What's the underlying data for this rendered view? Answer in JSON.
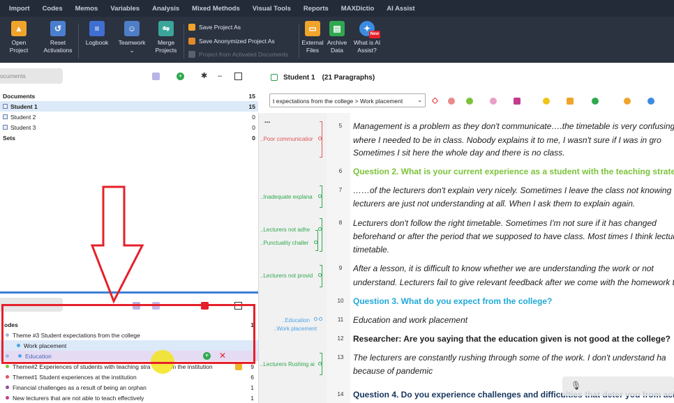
{
  "menu": [
    "Import",
    "Codes",
    "Memos",
    "Variables",
    "Analysis",
    "Mixed Methods",
    "Visual Tools",
    "Reports",
    "MAXDictio",
    "AI Assist"
  ],
  "ribbon": {
    "open_project": "Open Project",
    "reset_activations": "Reset Activations",
    "logbook": "Logbook",
    "teamwork": "Teamwork",
    "merge_projects": "Merge Projects",
    "save_project_as": "Save Project As",
    "save_anonymized": "Save Anonymized Project As",
    "project_from_activated": "Project from Activated Documents",
    "external_files": "External Files",
    "archive_data": "Archive Data",
    "what_is_ai": "What is AI Assist?",
    "new_badge": "New"
  },
  "documents_panel": {
    "search_placeholder": "ocuments",
    "root": {
      "label": "Documents",
      "count": "15"
    },
    "items": [
      {
        "label": "Student 1",
        "count": "15"
      },
      {
        "label": "Student 2",
        "count": "0"
      },
      {
        "label": "Student 3",
        "count": "0"
      }
    ],
    "sets": {
      "label": "Sets",
      "count": "0"
    }
  },
  "codes_panel": {
    "root": {
      "label": "odes",
      "count": "1"
    },
    "items": [
      {
        "label": "Theme #3 Student expectations from the college",
        "count": "",
        "color": "#9fb9d9"
      },
      {
        "label": "Work placement",
        "count": "",
        "color": "#4da3e6"
      },
      {
        "label": "Education",
        "count": "",
        "color": "#4da3e6"
      },
      {
        "label": "Theme#2 Experiences of students with teaching stra",
        "label_end": "in the institution",
        "count": "9",
        "color": "#7bc33a"
      },
      {
        "label": "Theme#1 Student experiences at the institution",
        "count": "6",
        "color": "#e05555"
      },
      {
        "label": "Financial challenges as a result of being an orphan",
        "count": "1",
        "color": "#8a4f9e"
      },
      {
        "label": "New lecturers that are not able to teach effectively",
        "count": "1",
        "color": "#c23c8f"
      }
    ]
  },
  "document_view": {
    "title": "Student 1",
    "subtitle": "(21 Paragraphs)",
    "code_path": "t expectations from the college  > Work placement",
    "code_tags": [
      "..Poor communicatior",
      "..Inadequate explana",
      "..Lecturers not adhe",
      "..Punctuality challer",
      "..Lecturers not provid",
      "..Education",
      "..Work placement",
      "..Lecturers Rushing ai"
    ],
    "ellipsis": "...",
    "paragraphs": [
      {
        "num": "5",
        "lines": [
          " Management is a problem as they don't communicate….the timetable is very confusing",
          "where I needed to be in class. Nobody explains it to me, I wasn't sure if I was in gro",
          "Sometimes I sit here the whole day and there is no class."
        ]
      },
      {
        "num": "6",
        "lines": [
          "Question 2. What is your current experience as a student with the teaching strateg"
        ]
      },
      {
        "num": "7",
        "lines": [
          "……of the lecturers don't explain very nicely. Sometimes I leave the class not knowing",
          "lecturers are just not understanding at all. When I ask them to explain again."
        ]
      },
      {
        "num": "8",
        "lines": [
          "Lecturers don't follow the right timetable. Sometimes I'm not sure if it has changed",
          "beforehand or after the period that we supposed to have class. Most times I think lectur",
          "timetable."
        ]
      },
      {
        "num": "9",
        "lines": [
          "After a lesson, it is difficult to know whether we are understanding the work or not",
          "understand. Lecturers fail to give relevant feedback after we come with the homework tha"
        ]
      },
      {
        "num": "10",
        "lines": [
          "Question 3. What do you expect from the college?"
        ]
      },
      {
        "num": "11",
        "lines": [
          "Education and work placement"
        ]
      },
      {
        "num": "12",
        "lines": [
          "Researcher: Are you saying that the education given is not good at the college?"
        ]
      },
      {
        "num": "13",
        "lines": [
          "The lecturers are constantly rushing through some of the work. I don't understand ha",
          "because of pandemic"
        ]
      },
      {
        "num": "14",
        "lines": [
          "Question 4. Do you experience challenges and difficulties that deter you from achi"
        ]
      }
    ]
  },
  "colors": {
    "accent_blue": "#3c7fd6",
    "highlight_red": "#e5202a",
    "green": "#7bc33a",
    "cyan": "#1fa9d8"
  }
}
